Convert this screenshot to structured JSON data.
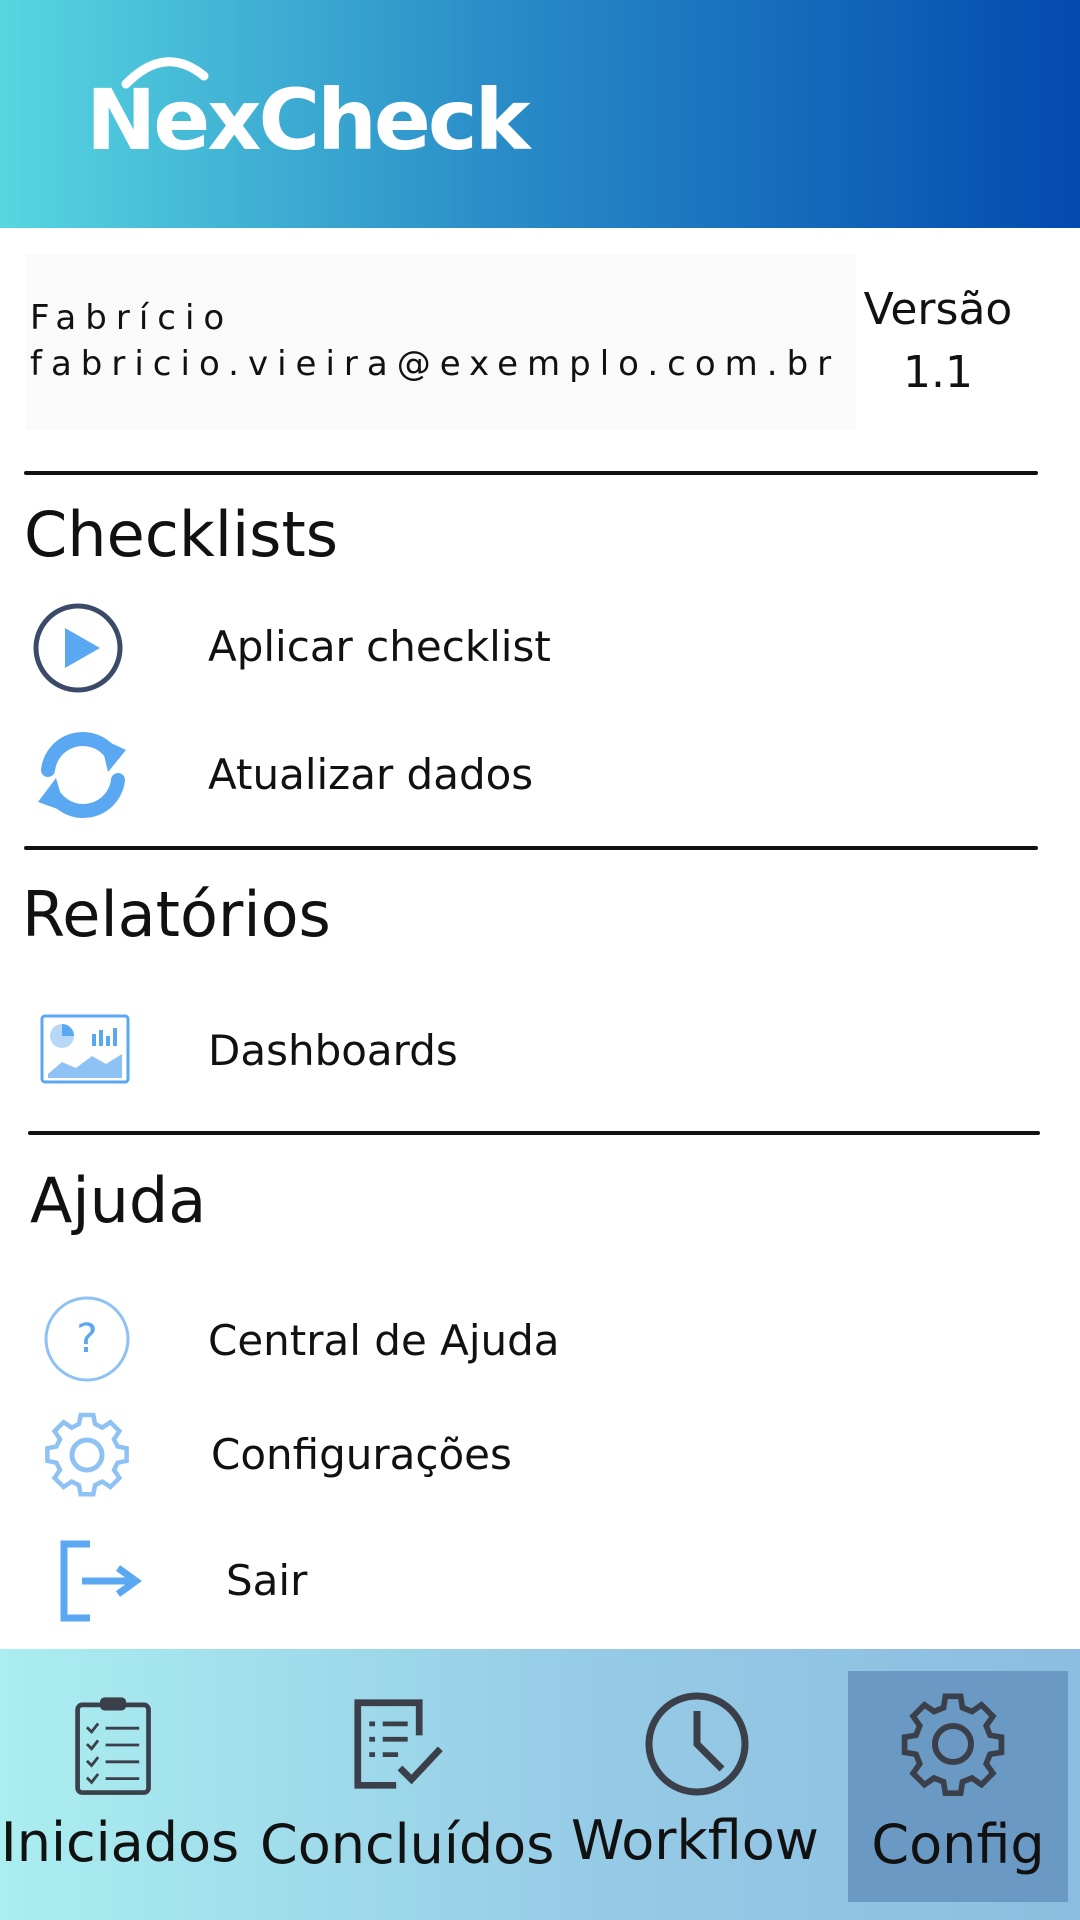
{
  "header": {
    "logo_text": "NexCheck",
    "gradient_start": "#57d6e0",
    "gradient_end": "#034aaf"
  },
  "user": {
    "name": "Fabrício",
    "email": "fabricio.vieira@exemplo.com.br"
  },
  "version": {
    "label": "Versão",
    "value": "1.1"
  },
  "sections": {
    "checklists": {
      "title": "Checklists",
      "items": [
        {
          "label": "Aplicar checklist",
          "icon": "play-circle-icon"
        },
        {
          "label": "Atualizar dados",
          "icon": "sync-icon"
        }
      ]
    },
    "relatorios": {
      "title": "Relatórios",
      "items": [
        {
          "label": "Dashboards",
          "icon": "dashboard-chart-icon"
        }
      ]
    },
    "ajuda": {
      "title": "Ajuda",
      "items": [
        {
          "label": "Central de Ajuda",
          "icon": "help-circle-icon"
        },
        {
          "label": "Configurações",
          "icon": "gear-icon"
        },
        {
          "label": "Sair",
          "icon": "logout-icon"
        }
      ]
    }
  },
  "bottom_nav": {
    "active_tab": "Config",
    "active_color": "#6a9ac4",
    "tabs": [
      {
        "label": "Iniciados",
        "icon": "clipboard-checklist-icon"
      },
      {
        "label": "Concluídos",
        "icon": "document-check-icon"
      },
      {
        "label": "Workflow",
        "icon": "clock-icon"
      },
      {
        "label": "Config",
        "icon": "gear-icon"
      }
    ]
  },
  "colors": {
    "icon_blue": "#5aa8f2",
    "icon_light_blue": "#8ec2f4",
    "icon_dark": "#3a3f4a"
  }
}
